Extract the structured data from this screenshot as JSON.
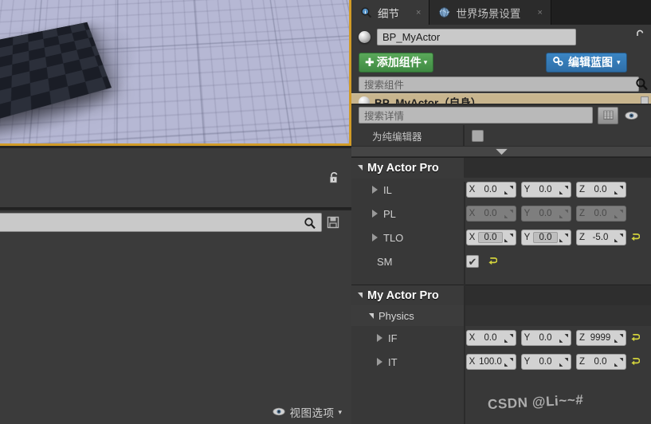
{
  "viewport": {
    "name": "level-viewport",
    "selection_border_color": "#d19b27",
    "floor_color": "#b6b8d4",
    "object_color": "#1a1d26"
  },
  "left_panel": {
    "lock_icon": "unlock-icon",
    "search": {
      "value": "",
      "placeholder": ""
    },
    "search_icon": "search-icon",
    "save_icon": "save-icon",
    "view_options": {
      "label": "视图选项",
      "icon": "eye-icon",
      "caret": "▾"
    }
  },
  "tabs": [
    {
      "label": "细节",
      "icon": "details-search-icon",
      "active": true,
      "close": "×"
    },
    {
      "label": "世界场景设置",
      "icon": "globe-icon",
      "active": false,
      "close": "×"
    }
  ],
  "actor": {
    "icon": "sphere-icon",
    "name_value": "BP_MyActor",
    "lock_icon": "unlock-icon"
  },
  "toolbar": {
    "add_component_label": "添加组件",
    "add_component_plus": "✚",
    "add_component_caret": "▾",
    "edit_blueprint_label": "编辑蓝图",
    "edit_blueprint_icon": "gears-icon",
    "edit_blueprint_caret": "▾"
  },
  "component_search": {
    "placeholder": "搜索组件",
    "value": "",
    "icon": "search-icon"
  },
  "component_tree": {
    "selected_label": "BP_MyActor（自身）",
    "icon": "sphere-icon"
  },
  "details_search": {
    "placeholder": "搜索详情",
    "value": "",
    "icon": "search-icon",
    "grid_button": "grid-view-icon",
    "eye_button": "eye-icon"
  },
  "editor_only": {
    "label": "为纯编辑器",
    "checked": false
  },
  "collapse_bar": {
    "icon": "chevron-down-icon"
  },
  "sections": [
    {
      "title": "My Actor Pro",
      "expanded": true,
      "rows": [
        {
          "label": "IL",
          "expandable": true,
          "type": "vector",
          "disabled": false,
          "reset": false,
          "boxed": false,
          "fields": [
            {
              "axis": "X",
              "value": "0.0"
            },
            {
              "axis": "Y",
              "value": "0.0"
            },
            {
              "axis": "Z",
              "value": "0.0"
            }
          ]
        },
        {
          "label": "PL",
          "expandable": true,
          "type": "vector",
          "disabled": true,
          "reset": false,
          "boxed": false,
          "fields": [
            {
              "axis": "X",
              "value": "0.0"
            },
            {
              "axis": "Y",
              "value": "0.0"
            },
            {
              "axis": "Z",
              "value": "0.0"
            }
          ]
        },
        {
          "label": "TLO",
          "expandable": true,
          "type": "vector",
          "disabled": false,
          "reset": true,
          "boxed": true,
          "fields": [
            {
              "axis": "X",
              "value": "0.0"
            },
            {
              "axis": "Y",
              "value": "0.0"
            },
            {
              "axis": "Z",
              "value": "-5.0"
            }
          ]
        },
        {
          "label": "SM",
          "expandable": false,
          "type": "checkbox",
          "checked": true,
          "check_glyph": "✔",
          "reset": true
        }
      ]
    },
    {
      "title": "My Actor Pro",
      "expanded": true,
      "subgroup": {
        "title": "Physics",
        "expanded": true
      },
      "rows": [
        {
          "label": "IF",
          "expandable": true,
          "type": "vector",
          "disabled": false,
          "reset": true,
          "boxed": false,
          "fields": [
            {
              "axis": "X",
              "value": "0.0"
            },
            {
              "axis": "Y",
              "value": "0.0"
            },
            {
              "axis": "Z",
              "value": "9999"
            }
          ]
        },
        {
          "label": "IT",
          "expandable": true,
          "type": "vector",
          "disabled": false,
          "reset": true,
          "boxed": false,
          "fields": [
            {
              "axis": "X",
              "value": "100.0"
            },
            {
              "axis": "Y",
              "value": "0.0"
            },
            {
              "axis": "Z",
              "value": "0.0"
            }
          ]
        }
      ]
    }
  ],
  "watermark": {
    "text": "CSDN @Li~~#"
  },
  "colors": {
    "accent_green": "#4d9a50",
    "accent_blue": "#3b86c4",
    "selection_tan": "#c8b58e",
    "reset_yellow": "#d2d23c",
    "panel_bg": "#383838"
  }
}
